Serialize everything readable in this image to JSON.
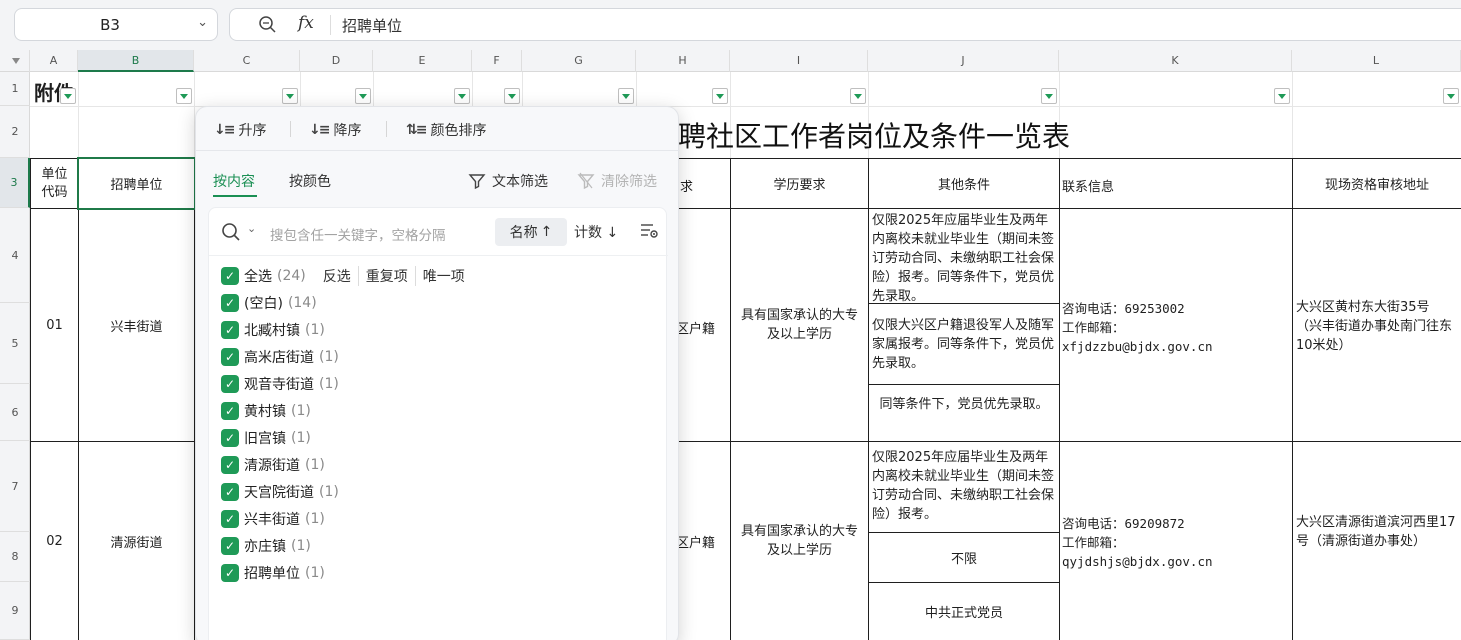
{
  "formula_bar": {
    "name_box": "B3",
    "zoom_icon": "zoom-icon",
    "fx_label": "fx",
    "content": "招聘单位"
  },
  "columns": [
    "A",
    "B",
    "C",
    "D",
    "E",
    "F",
    "G",
    "H",
    "I",
    "J",
    "K",
    "L"
  ],
  "rows": [
    "1",
    "2",
    "3",
    "4",
    "5",
    "6",
    "7",
    "8",
    "9"
  ],
  "sheet": {
    "a1": "附件",
    "title_visible": "聘社区工作者岗位及条件一览表",
    "headers": {
      "unit_code": "单位代码",
      "unit": "招聘单位",
      "h_partial": "求",
      "education": "学历要求",
      "other": "其他条件",
      "contact": "联系信息",
      "address": "现场资格审核地址"
    },
    "groups": [
      {
        "code": "01",
        "unit": "兴丰街道",
        "h_partial": "区户籍",
        "education": "具有国家承认的大专及以上学历",
        "conditions": [
          "仅限2025年应届毕业生及两年内离校未就业毕业生（期间未签订劳动合同、未缴纳职工社会保险）报考。同等条件下，党员优先录取。",
          "仅限大兴区户籍退役军人及随军家属报考。同等条件下，党员优先录取。",
          "同等条件下，党员优先录取。"
        ],
        "phone": "咨询电话：69253002",
        "email_label": "工作邮箱：",
        "email": "xfjdzzbu@bjdx.gov.cn",
        "address": "大兴区黄村东大街35号（兴丰街道办事处南门往东10米处）"
      },
      {
        "code": "02",
        "unit": "清源街道",
        "h_partial": "区户籍",
        "education": "具有国家承认的大专及以上学历",
        "conditions": [
          "仅限2025年应届毕业生及两年内离校未就业毕业生（期间未签订劳动合同、未缴纳职工社会保险）报考。",
          "不限",
          "中共正式党员"
        ],
        "phone": "咨询电话：69209872",
        "email_label": "工作邮箱：",
        "email": "qyjdshjs@bjdx.gov.cn",
        "address": "大兴区清源街道滨河西里17号（清源街道办事处）"
      }
    ]
  },
  "filter_panel": {
    "sort": {
      "asc": "升序",
      "desc": "降序",
      "color": "颜色排序"
    },
    "tabs": {
      "by_content": "按内容",
      "by_color": "按颜色"
    },
    "text_filter": "文本筛选",
    "clear_filter": "清除筛选",
    "search_placeholder": "搜包含任一关键字，空格分隔",
    "sort_name": "名称",
    "sort_count": "计数",
    "select_all": {
      "label": "全选",
      "count": "(24)",
      "invert": "反选",
      "duplicates": "重复项",
      "unique": "唯一项"
    },
    "items": [
      {
        "label": "(空白)",
        "count": "(14)"
      },
      {
        "label": "北臧村镇",
        "count": "(1)"
      },
      {
        "label": "高米店街道",
        "count": "(1)"
      },
      {
        "label": "观音寺街道",
        "count": "(1)"
      },
      {
        "label": "黄村镇",
        "count": "(1)"
      },
      {
        "label": "旧宫镇",
        "count": "(1)"
      },
      {
        "label": "清源街道",
        "count": "(1)"
      },
      {
        "label": "天宫院街道",
        "count": "(1)"
      },
      {
        "label": "兴丰街道",
        "count": "(1)"
      },
      {
        "label": "亦庄镇",
        "count": "(1)"
      },
      {
        "label": "招聘单位",
        "count": "(1)"
      }
    ]
  },
  "colors": {
    "accent": "#1f9a57",
    "selection": "#1f7a48",
    "header_bg": "#f3f4f6"
  }
}
